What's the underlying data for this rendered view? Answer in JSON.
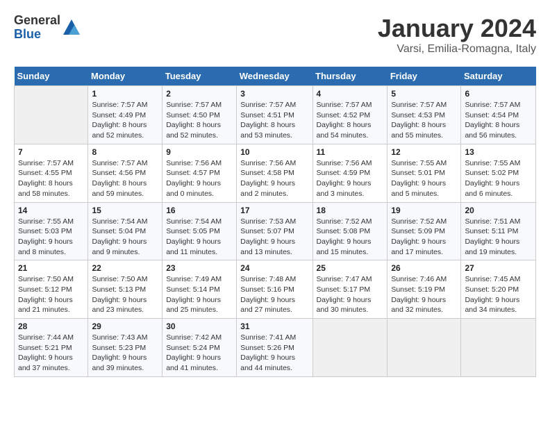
{
  "logo": {
    "general": "General",
    "blue": "Blue"
  },
  "title": "January 2024",
  "subtitle": "Varsi, Emilia-Romagna, Italy",
  "days_header": [
    "Sunday",
    "Monday",
    "Tuesday",
    "Wednesday",
    "Thursday",
    "Friday",
    "Saturday"
  ],
  "weeks": [
    [
      {
        "day": "",
        "sunrise": "",
        "sunset": "",
        "daylight": ""
      },
      {
        "day": "1",
        "sunrise": "Sunrise: 7:57 AM",
        "sunset": "Sunset: 4:49 PM",
        "daylight": "Daylight: 8 hours and 52 minutes."
      },
      {
        "day": "2",
        "sunrise": "Sunrise: 7:57 AM",
        "sunset": "Sunset: 4:50 PM",
        "daylight": "Daylight: 8 hours and 52 minutes."
      },
      {
        "day": "3",
        "sunrise": "Sunrise: 7:57 AM",
        "sunset": "Sunset: 4:51 PM",
        "daylight": "Daylight: 8 hours and 53 minutes."
      },
      {
        "day": "4",
        "sunrise": "Sunrise: 7:57 AM",
        "sunset": "Sunset: 4:52 PM",
        "daylight": "Daylight: 8 hours and 54 minutes."
      },
      {
        "day": "5",
        "sunrise": "Sunrise: 7:57 AM",
        "sunset": "Sunset: 4:53 PM",
        "daylight": "Daylight: 8 hours and 55 minutes."
      },
      {
        "day": "6",
        "sunrise": "Sunrise: 7:57 AM",
        "sunset": "Sunset: 4:54 PM",
        "daylight": "Daylight: 8 hours and 56 minutes."
      }
    ],
    [
      {
        "day": "7",
        "sunrise": "Sunrise: 7:57 AM",
        "sunset": "Sunset: 4:55 PM",
        "daylight": "Daylight: 8 hours and 58 minutes."
      },
      {
        "day": "8",
        "sunrise": "Sunrise: 7:57 AM",
        "sunset": "Sunset: 4:56 PM",
        "daylight": "Daylight: 8 hours and 59 minutes."
      },
      {
        "day": "9",
        "sunrise": "Sunrise: 7:56 AM",
        "sunset": "Sunset: 4:57 PM",
        "daylight": "Daylight: 9 hours and 0 minutes."
      },
      {
        "day": "10",
        "sunrise": "Sunrise: 7:56 AM",
        "sunset": "Sunset: 4:58 PM",
        "daylight": "Daylight: 9 hours and 2 minutes."
      },
      {
        "day": "11",
        "sunrise": "Sunrise: 7:56 AM",
        "sunset": "Sunset: 4:59 PM",
        "daylight": "Daylight: 9 hours and 3 minutes."
      },
      {
        "day": "12",
        "sunrise": "Sunrise: 7:55 AM",
        "sunset": "Sunset: 5:01 PM",
        "daylight": "Daylight: 9 hours and 5 minutes."
      },
      {
        "day": "13",
        "sunrise": "Sunrise: 7:55 AM",
        "sunset": "Sunset: 5:02 PM",
        "daylight": "Daylight: 9 hours and 6 minutes."
      }
    ],
    [
      {
        "day": "14",
        "sunrise": "Sunrise: 7:55 AM",
        "sunset": "Sunset: 5:03 PM",
        "daylight": "Daylight: 9 hours and 8 minutes."
      },
      {
        "day": "15",
        "sunrise": "Sunrise: 7:54 AM",
        "sunset": "Sunset: 5:04 PM",
        "daylight": "Daylight: 9 hours and 9 minutes."
      },
      {
        "day": "16",
        "sunrise": "Sunrise: 7:54 AM",
        "sunset": "Sunset: 5:05 PM",
        "daylight": "Daylight: 9 hours and 11 minutes."
      },
      {
        "day": "17",
        "sunrise": "Sunrise: 7:53 AM",
        "sunset": "Sunset: 5:07 PM",
        "daylight": "Daylight: 9 hours and 13 minutes."
      },
      {
        "day": "18",
        "sunrise": "Sunrise: 7:52 AM",
        "sunset": "Sunset: 5:08 PM",
        "daylight": "Daylight: 9 hours and 15 minutes."
      },
      {
        "day": "19",
        "sunrise": "Sunrise: 7:52 AM",
        "sunset": "Sunset: 5:09 PM",
        "daylight": "Daylight: 9 hours and 17 minutes."
      },
      {
        "day": "20",
        "sunrise": "Sunrise: 7:51 AM",
        "sunset": "Sunset: 5:11 PM",
        "daylight": "Daylight: 9 hours and 19 minutes."
      }
    ],
    [
      {
        "day": "21",
        "sunrise": "Sunrise: 7:50 AM",
        "sunset": "Sunset: 5:12 PM",
        "daylight": "Daylight: 9 hours and 21 minutes."
      },
      {
        "day": "22",
        "sunrise": "Sunrise: 7:50 AM",
        "sunset": "Sunset: 5:13 PM",
        "daylight": "Daylight: 9 hours and 23 minutes."
      },
      {
        "day": "23",
        "sunrise": "Sunrise: 7:49 AM",
        "sunset": "Sunset: 5:14 PM",
        "daylight": "Daylight: 9 hours and 25 minutes."
      },
      {
        "day": "24",
        "sunrise": "Sunrise: 7:48 AM",
        "sunset": "Sunset: 5:16 PM",
        "daylight": "Daylight: 9 hours and 27 minutes."
      },
      {
        "day": "25",
        "sunrise": "Sunrise: 7:47 AM",
        "sunset": "Sunset: 5:17 PM",
        "daylight": "Daylight: 9 hours and 30 minutes."
      },
      {
        "day": "26",
        "sunrise": "Sunrise: 7:46 AM",
        "sunset": "Sunset: 5:19 PM",
        "daylight": "Daylight: 9 hours and 32 minutes."
      },
      {
        "day": "27",
        "sunrise": "Sunrise: 7:45 AM",
        "sunset": "Sunset: 5:20 PM",
        "daylight": "Daylight: 9 hours and 34 minutes."
      }
    ],
    [
      {
        "day": "28",
        "sunrise": "Sunrise: 7:44 AM",
        "sunset": "Sunset: 5:21 PM",
        "daylight": "Daylight: 9 hours and 37 minutes."
      },
      {
        "day": "29",
        "sunrise": "Sunrise: 7:43 AM",
        "sunset": "Sunset: 5:23 PM",
        "daylight": "Daylight: 9 hours and 39 minutes."
      },
      {
        "day": "30",
        "sunrise": "Sunrise: 7:42 AM",
        "sunset": "Sunset: 5:24 PM",
        "daylight": "Daylight: 9 hours and 41 minutes."
      },
      {
        "day": "31",
        "sunrise": "Sunrise: 7:41 AM",
        "sunset": "Sunset: 5:26 PM",
        "daylight": "Daylight: 9 hours and 44 minutes."
      },
      {
        "day": "",
        "sunrise": "",
        "sunset": "",
        "daylight": ""
      },
      {
        "day": "",
        "sunrise": "",
        "sunset": "",
        "daylight": ""
      },
      {
        "day": "",
        "sunrise": "",
        "sunset": "",
        "daylight": ""
      }
    ]
  ]
}
